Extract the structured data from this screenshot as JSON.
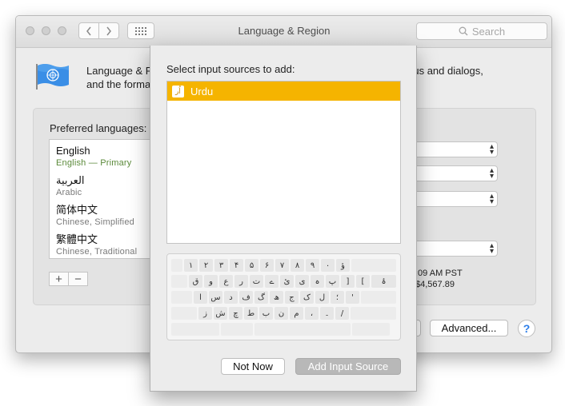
{
  "window": {
    "title": "Language & Region",
    "search_placeholder": "Search"
  },
  "header": {
    "line1_left": "Language & R",
    "line1_right": "nus and dialogs,",
    "line2_left": "and the forma"
  },
  "preferred": {
    "label": "Preferred languages:",
    "languages": [
      {
        "name": "English",
        "sub": "English — Primary"
      },
      {
        "name": "العربية",
        "sub": "Arabic"
      },
      {
        "name": "简体中文",
        "sub": "Chinese, Simplified"
      },
      {
        "name": "繁體中文",
        "sub": "Chinese, Traditional"
      }
    ],
    "add_label": "+",
    "remove_label": "−"
  },
  "format": {
    "time_example": ":09 AM PST",
    "number_example": "$4,567.89"
  },
  "buttons": {
    "advanced": "Advanced...",
    "help": "?"
  },
  "sheet": {
    "title": "Select input sources to add:",
    "sources": [
      {
        "name": "Urdu",
        "icon_text": "اُر",
        "selected": true
      }
    ],
    "keyboard_rows": [
      [
        "",
        "١",
        "٢",
        "٣",
        "۴",
        "۵",
        "۶",
        "٧",
        "٨",
        "٩",
        "٠",
        "ؤ",
        ""
      ],
      [
        "",
        "ق",
        "و",
        "ع",
        "ر",
        "ت",
        "ے",
        "ئ",
        "ی",
        "ہ",
        "پ",
        "]",
        "[",
        "ۂ"
      ],
      [
        "",
        "ا",
        "س",
        "د",
        "ف",
        "گ",
        "ھ",
        "ج",
        "ک",
        "ل",
        "؛",
        "'",
        ""
      ],
      [
        "",
        "ز",
        "ش",
        "چ",
        "ط",
        "ب",
        "ن",
        "م",
        "،",
        "۔",
        "/",
        ""
      ],
      [
        "",
        "",
        "",
        ""
      ]
    ],
    "not_now": "Not Now",
    "add_source": "Add Input Source"
  },
  "colors": {
    "selection": "#f5b400",
    "accent": "#2b7de9"
  },
  "icons": {
    "flag": "un-flag-icon",
    "back": "chevron-left-icon",
    "forward": "chevron-right-icon",
    "grid": "grid-icon",
    "search": "search-icon"
  }
}
